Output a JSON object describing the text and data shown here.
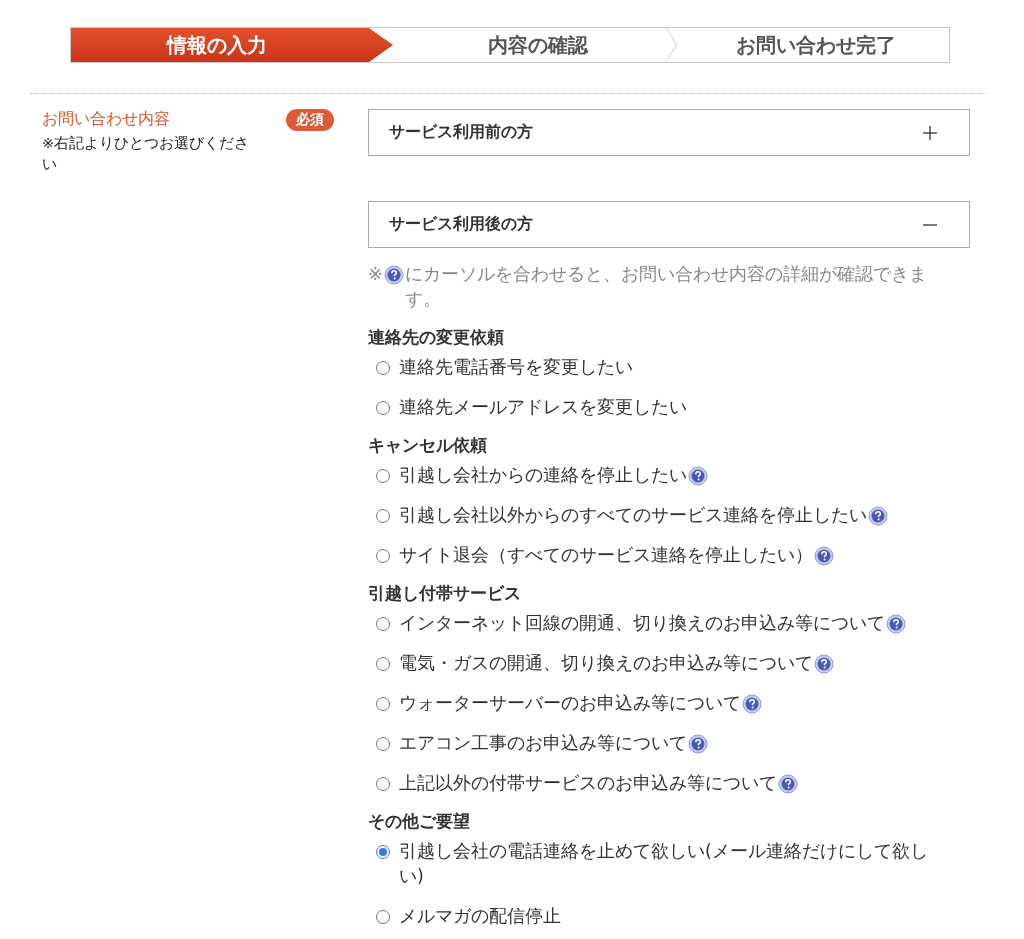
{
  "steps": [
    {
      "label": "情報の入力",
      "selected": true
    },
    {
      "label": "内容の確認",
      "selected": false
    },
    {
      "label": "お問い合わせ完了",
      "selected": false
    }
  ],
  "field": {
    "label": "お問い合わせ内容",
    "hint": "※右記よりひとつお選びください",
    "badge": "必須"
  },
  "accordions": [
    {
      "title": "サービス利用前の方",
      "expanded": false
    },
    {
      "title": "サービス利用後の方",
      "expanded": true
    }
  ],
  "note": {
    "prefix": "※",
    "text": "にカーソルを合わせると、お問い合わせ内容の詳細が確認できます。"
  },
  "groups": [
    {
      "heading": "連絡先の変更依頼",
      "options": [
        {
          "label": "連絡先電話番号を変更したい",
          "selected": false,
          "help": false
        },
        {
          "label": "連絡先メールアドレスを変更したい",
          "selected": false,
          "help": false
        }
      ]
    },
    {
      "heading": "キャンセル依頼",
      "options": [
        {
          "label": "引越し会社からの連絡を停止したい",
          "selected": false,
          "help": true
        },
        {
          "label": "引越し会社以外からのすべてのサービス連絡を停止したい",
          "selected": false,
          "help": true
        },
        {
          "label": "サイト退会（すべてのサービス連絡を停止したい）",
          "selected": false,
          "help": true
        }
      ]
    },
    {
      "heading": "引越し付帯サービス",
      "options": [
        {
          "label": "インターネット回線の開通、切り換えのお申込み等について",
          "selected": false,
          "help": true
        },
        {
          "label": "電気・ガスの開通、切り換えのお申込み等について",
          "selected": false,
          "help": true
        },
        {
          "label": "ウォーターサーバーのお申込み等について",
          "selected": false,
          "help": true
        },
        {
          "label": "エアコン工事のお申込み等について",
          "selected": false,
          "help": true
        },
        {
          "label": "上記以外の付帯サービスのお申込み等について",
          "selected": false,
          "help": true
        }
      ]
    },
    {
      "heading": "その他ご要望",
      "options": [
        {
          "label": "引越し会社の電話連絡を止めて欲しい(メール連絡だけにして欲しい)",
          "selected": true,
          "help": false
        },
        {
          "label": "メルマガの配信停止",
          "selected": false,
          "help": false
        }
      ]
    }
  ]
}
